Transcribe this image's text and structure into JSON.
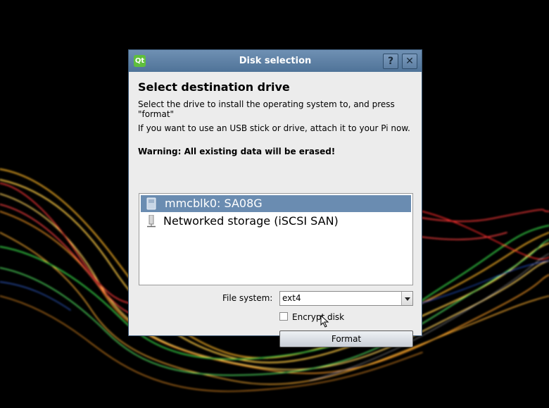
{
  "window": {
    "title": "Disk selection",
    "logo_text": "Qt",
    "help_label": "?",
    "close_label": "✕"
  },
  "content": {
    "heading": "Select destination drive",
    "description1": "Select the drive to install the operating system to, and press \"format\"",
    "description2": "If you want to use an USB stick or drive, attach it to your Pi now.",
    "warning": "Warning: All existing data will be erased!"
  },
  "drives": [
    {
      "label": "mmcblk0: SA08G",
      "icon": "sd-card-icon",
      "selected": true
    },
    {
      "label": "Networked storage (iSCSI SAN)",
      "icon": "network-storage-icon",
      "selected": false
    }
  ],
  "filesystem": {
    "label": "File system:",
    "value": "ext4"
  },
  "encrypt": {
    "label": "Encrypt disk",
    "checked": false
  },
  "format_button": {
    "label": "Format"
  },
  "colors": {
    "titlebar": "#5b7fa6",
    "selection": "#6a8cb1",
    "window_bg": "#ececec"
  }
}
